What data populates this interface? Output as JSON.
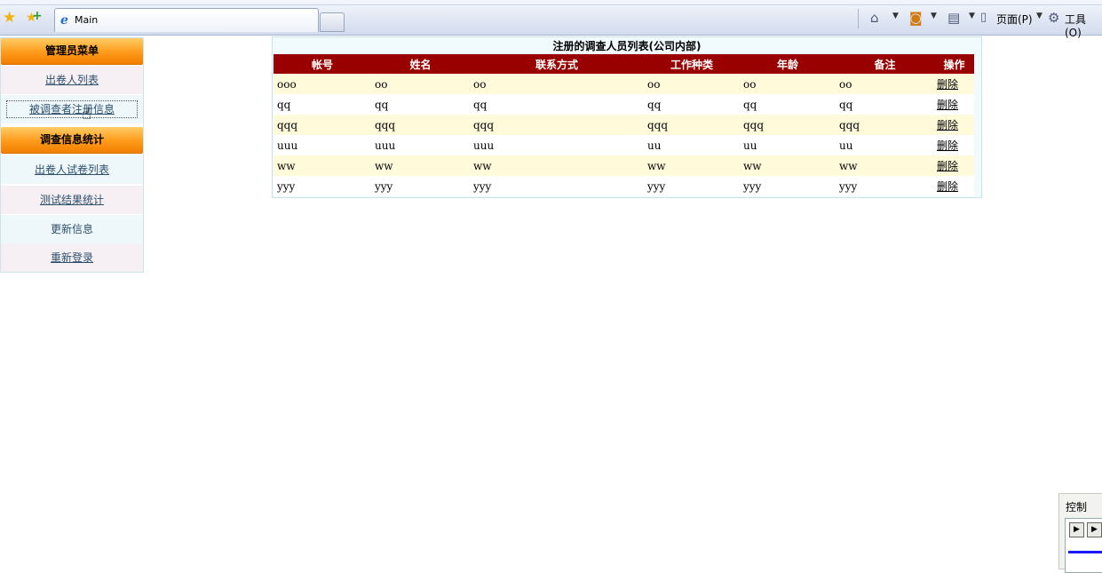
{
  "browser": {
    "tab_title": "Main",
    "page_menu": "页面(P)",
    "tools_menu": "工具(O)"
  },
  "sidebar": {
    "section1_title": "管理员菜单",
    "item_respondent_list": "出卷人列表",
    "item_surveyed_registration": "被调查者注册信息",
    "section2_title": "调查信息统计",
    "item_paper_list": "出卷人试卷列表",
    "item_test_stats": "测试结果统计",
    "item_update_info": "更新信息",
    "item_relogin": "重新登录"
  },
  "table": {
    "title": "注册的调查人员列表(公司内部)",
    "columns": [
      "帐号",
      "姓名",
      "联系方式",
      "工作种类",
      "年龄",
      "备注",
      "操作"
    ],
    "delete_label": "删除",
    "rows": [
      [
        "ooo",
        "oo",
        "oo",
        "oo",
        "oo",
        "oo"
      ],
      [
        "qq",
        "qq",
        "qq",
        "qq",
        "qq",
        "qq"
      ],
      [
        "qqq",
        "qqq",
        "qqq",
        "qqq",
        "qqq",
        "qqq"
      ],
      [
        "uuu",
        "uuu",
        "uuu",
        "uu",
        "uu",
        "uu"
      ],
      [
        "ww",
        "ww",
        "ww",
        "ww",
        "ww",
        "ww"
      ],
      [
        "yyy",
        "yyy",
        "yyy",
        "yyy",
        "yyy",
        "yyy"
      ]
    ]
  },
  "control_widget": {
    "title": "控制"
  },
  "colors": {
    "header_bg": "#990000",
    "row_alt_bg": "#fffad9",
    "menu_head_orange": "#ff9a1a"
  }
}
